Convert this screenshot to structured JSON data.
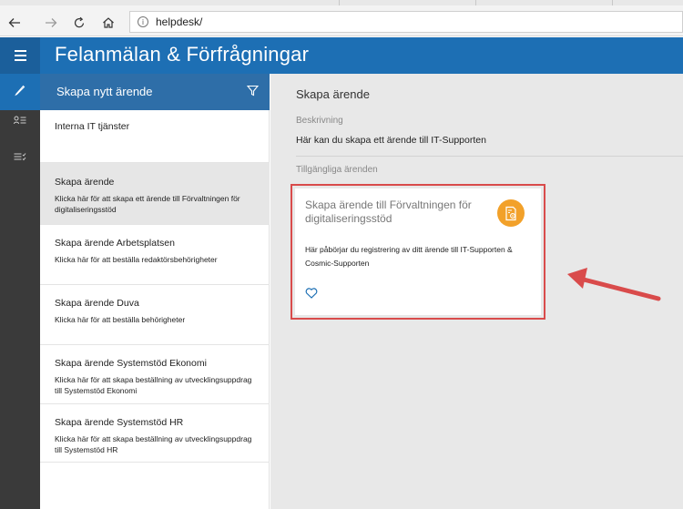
{
  "browser": {
    "url": "helpdesk/"
  },
  "app": {
    "title": "Felanmälan & Förfrågningar"
  },
  "list": {
    "header": "Skapa nytt ärende",
    "items": [
      {
        "title": "Interna IT tjänster",
        "desc": ""
      },
      {
        "title": "Skapa ärende",
        "desc": "Klicka här för att skapa ett ärende till Förvaltningen för digitaliseringsstöd"
      },
      {
        "title": "Skapa ärende Arbetsplatsen",
        "desc": "Klicka här för att beställa redaktörsbehörigheter"
      },
      {
        "title": "Skapa ärende Duva",
        "desc": "Klicka här för att beställa behörigheter"
      },
      {
        "title": "Skapa ärende Systemstöd Ekonomi",
        "desc": "Klicka här för att skapa beställning av utvecklingsuppdrag till Systemstöd Ekonomi"
      },
      {
        "title": "Skapa ärende Systemstöd HR",
        "desc": "Klicka här för att skapa beställning av utvecklingsuppdrag till Systemstöd HR"
      }
    ]
  },
  "main": {
    "title": "Skapa ärende",
    "description_label": "Beskrivning",
    "description_value": "Här kan du skapa ett ärende till IT-Supporten",
    "available_label": "Tillgängliga ärenden",
    "card": {
      "title": "Skapa ärende till Förvaltningen för digitaliseringsstöd",
      "description": "Här påbörjar du registrering av ditt ärende till IT-Supporten & Cosmic-Supporten"
    }
  },
  "colors": {
    "header_blue": "#1d6fb4",
    "list_header_blue": "#2e6ea8",
    "rail_dark": "#3a3a3a",
    "card_icon_orange": "#f2a12a",
    "highlight_red": "#d94b4b"
  },
  "icons": {
    "back": "back-arrow-icon",
    "forward": "forward-arrow-icon",
    "refresh": "refresh-icon",
    "home": "home-icon",
    "info": "info-icon",
    "menu": "hamburger-menu-icon",
    "pencil": "pencil-icon",
    "user_list": "user-list-icon",
    "task_list": "task-list-icon",
    "filter": "filter-icon",
    "card": "document-gear-icon",
    "favorite": "heart-icon"
  }
}
